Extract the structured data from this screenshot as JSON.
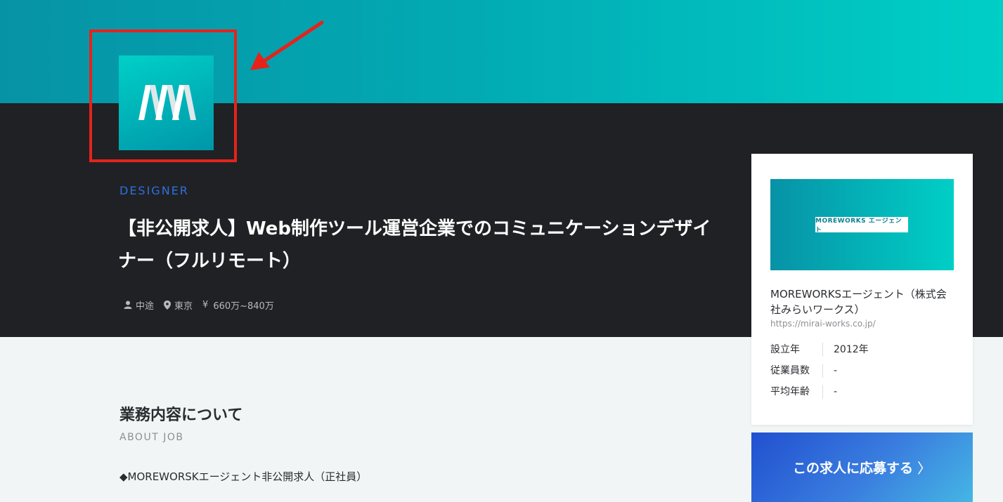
{
  "header": {
    "category": "DESIGNER",
    "job_title": "【非公開求人】Web制作ツール運営企業でのコミュニケーションデザイナー（フルリモート）",
    "employment_type": "中途",
    "location": "東京",
    "salary_symbol": "¥",
    "salary": "660万~840万"
  },
  "main": {
    "section_title": "業務内容について",
    "section_subtitle": "ABOUT JOB",
    "body_text": "◆MOREWORSKエージェント非公開求人（正社員）"
  },
  "company_card": {
    "banner_text": "MOREWORKS エージェント",
    "name": "MOREWORKSエージェント（株式会社みらいワークス）",
    "url": "https://mirai-works.co.jp/",
    "info": [
      {
        "label": "設立年",
        "value": "2012年"
      },
      {
        "label": "従業員数",
        "value": "-"
      },
      {
        "label": "平均年齢",
        "value": "-"
      }
    ]
  },
  "apply": {
    "label": "この求人に応募する",
    "chevron": "〉"
  },
  "colors": {
    "accent_blue": "#2f6fe0",
    "highlight_red": "#e5231b",
    "teal": "#00cfc6",
    "dark_bg": "#202124"
  },
  "icons": [
    "company-logo-icon",
    "user-icon",
    "location-pin-icon",
    "yen-icon",
    "red-arrow-icon"
  ]
}
